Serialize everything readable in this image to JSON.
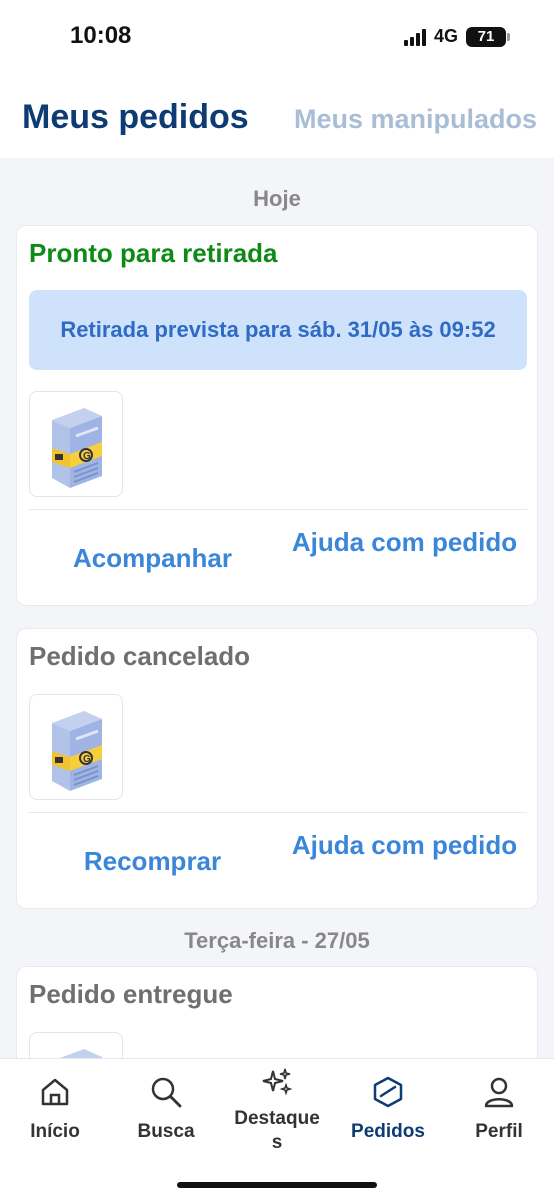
{
  "status_bar": {
    "time": "10:08",
    "network": "4G",
    "battery": "71"
  },
  "header": {
    "active_tab": "Meus pedidos",
    "inactive_tab": "Meus manipulados"
  },
  "sections": [
    {
      "title": "Hoje"
    },
    {
      "title": "Terça-feira - 27/05"
    }
  ],
  "orders": [
    {
      "status": "Pronto para retirada",
      "pickup_info": "Retirada prevista para sáb. 31/05 às 09:52",
      "action_primary": "Acompanhar",
      "action_help": "Ajuda com pedido"
    },
    {
      "status": "Pedido cancelado",
      "action_primary": "Recomprar",
      "action_help": "Ajuda com pedido"
    },
    {
      "status": "Pedido entregue"
    }
  ],
  "bottom_nav": {
    "items": [
      {
        "label": "Início",
        "icon": "home-icon"
      },
      {
        "label": "Busca",
        "icon": "search-icon"
      },
      {
        "label": "Destaques",
        "icon": "sparkles-icon"
      },
      {
        "label": "Pedidos",
        "icon": "box-icon",
        "active": true
      },
      {
        "label": "Perfil",
        "icon": "person-icon"
      }
    ]
  },
  "colors": {
    "brand_dark": "#0d3b73",
    "link_blue": "#3a86d9",
    "success_green": "#0e8a16",
    "pickup_bg": "#cfe2fb"
  }
}
